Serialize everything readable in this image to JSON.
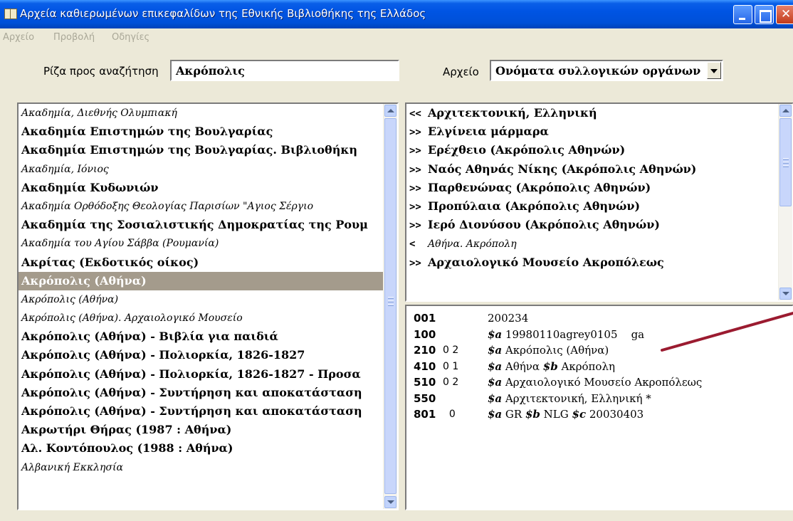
{
  "window": {
    "title": "Αρχεία καθιερωμένων επικεφαλίδων της Εθνικής Βιβλιοθήκης της Ελλάδος"
  },
  "menu": {
    "file": "Αρχείο",
    "view": "Προβολή",
    "help": "Οδηγίες"
  },
  "search": {
    "label": "Ρίζα προς αναζήτηση",
    "value": "Ακρόπολις"
  },
  "file_select": {
    "label": "Αρχείο",
    "value": "Ονόματα συλλογικών οργάνων"
  },
  "headings": [
    {
      "text": "Ακαδημία, Διεθνής Ολυμπιακή",
      "style": "italic"
    },
    {
      "text": "Ακαδημία Επιστημών της Βουλγαρίας",
      "style": "bold"
    },
    {
      "text": "Ακαδημία Επιστημών της Βουλγαρίας. Βιβλιοθήκη",
      "style": "bold"
    },
    {
      "text": "Ακαδημία, Ιόνιος",
      "style": "italic"
    },
    {
      "text": "Ακαδημία Κυδωνιών",
      "style": "bold"
    },
    {
      "text": "Ακαδημία Ορθόδοξης Θεολογίας Παρισίων \"Αγιος Σέργιο",
      "style": "italic"
    },
    {
      "text": "Ακαδημία της Σοσιαλιστικής Δημοκρατίας της Ρουμ",
      "style": "bold"
    },
    {
      "text": "Ακαδημία του Αγίου Σάββα (Ρουμανία)",
      "style": "italic"
    },
    {
      "text": "Ακρίτας (Εκδοτικός οίκος)",
      "style": "bold"
    },
    {
      "text": "Ακρόπολις (Αθήνα)",
      "style": "bold",
      "selected": true
    },
    {
      "text": "Ακρόπολις (Αθήνα)",
      "style": "italic"
    },
    {
      "text": "Ακρόπολις (Αθήνα). Αρχαιολογικό Μουσείο",
      "style": "italic"
    },
    {
      "text": "Ακρόπολις (Αθήνα) - Βιβλία για παιδιά",
      "style": "bold"
    },
    {
      "text": "Ακρόπολις (Αθήνα) - Πολιορκία, 1826-1827",
      "style": "bold"
    },
    {
      "text": "Ακρόπολις (Αθήνα) - Πολιορκία, 1826-1827 - Προσα",
      "style": "bold"
    },
    {
      "text": "Ακρόπολις (Αθήνα) - Συντήρηση και αποκατάσταση",
      "style": "bold"
    },
    {
      "text": "Ακρόπολις (Αθήνα) - Συντήρηση και αποκατάσταση",
      "style": "bold"
    },
    {
      "text": "Ακρωτήρι Θήρας (1987 : Αθήνα)",
      "style": "bold"
    },
    {
      "text": "Αλ. Κοντόπουλος (1988 : Αθήνα)",
      "style": "bold"
    },
    {
      "text": "Αλβανική Εκκλησία",
      "style": "italic"
    }
  ],
  "related": [
    {
      "marker": "<<",
      "text": "Αρχιτεκτονική, Ελληνική",
      "style": "bold"
    },
    {
      "marker": ">>",
      "text": "Ελγίνεια μάρμαρα",
      "style": "bold"
    },
    {
      "marker": ">>",
      "text": "Ερέχθειο (Ακρόπολις Αθηνών)",
      "style": "bold"
    },
    {
      "marker": ">>",
      "text": "Ναός Αθηνάς Νίκης (Ακρόπολις Αθηνών)",
      "style": "bold"
    },
    {
      "marker": ">>",
      "text": "Παρθενώνας (Ακρόπολις Αθηνών)",
      "style": "bold"
    },
    {
      "marker": ">>",
      "text": "Προπύλαια (Ακρόπολις Αθηνών)",
      "style": "bold"
    },
    {
      "marker": ">>",
      "text": "Ιερό Διονύσου (Ακρόπολις Αθηνών)",
      "style": "bold"
    },
    {
      "marker": "<",
      "text": "Αθήνα. Ακρόπολη",
      "style": "italic"
    },
    {
      "marker": ">>",
      "text": "Αρχαιολογικό Μουσείο Ακροπόλεως",
      "style": "bold"
    }
  ],
  "marc": [
    {
      "tag": "001",
      "ind": "",
      "parts": [
        {
          "t": "200234",
          "sub": false
        }
      ]
    },
    {
      "tag": "100",
      "ind": "",
      "parts": [
        {
          "t": "$a",
          "sub": true
        },
        {
          "t": " 19980110agrey0105    ga",
          "sub": false
        }
      ]
    },
    {
      "tag": "210",
      "ind": "0 2",
      "parts": [
        {
          "t": "$a",
          "sub": true
        },
        {
          "t": " Ακρόπολις (Αθήνα)",
          "sub": false
        }
      ]
    },
    {
      "tag": "410",
      "ind": "0 1",
      "parts": [
        {
          "t": "$a",
          "sub": true
        },
        {
          "t": " Αθήνα ",
          "sub": false
        },
        {
          "t": "$b",
          "sub": true
        },
        {
          "t": " Ακρόπολη",
          "sub": false
        }
      ]
    },
    {
      "tag": "510",
      "ind": "0 2",
      "parts": [
        {
          "t": "$a",
          "sub": true
        },
        {
          "t": " Αρχαιολογικό Μουσείο Ακροπόλεως",
          "sub": false
        }
      ]
    },
    {
      "tag": "550",
      "ind": "",
      "parts": [
        {
          "t": "$a",
          "sub": true
        },
        {
          "t": " Αρχιτεκτονική, Ελληνική *",
          "sub": false
        }
      ]
    },
    {
      "tag": "801",
      "ind": "  0",
      "parts": [
        {
          "t": "$a",
          "sub": true
        },
        {
          "t": " GR ",
          "sub": false
        },
        {
          "t": "$b",
          "sub": true
        },
        {
          "t": " NLG ",
          "sub": false
        },
        {
          "t": "$c",
          "sub": true
        },
        {
          "t": " 20030403",
          "sub": false
        }
      ]
    }
  ],
  "colors": {
    "selection": "#a49b8c",
    "annotation_arrow": "#9b1b30"
  }
}
